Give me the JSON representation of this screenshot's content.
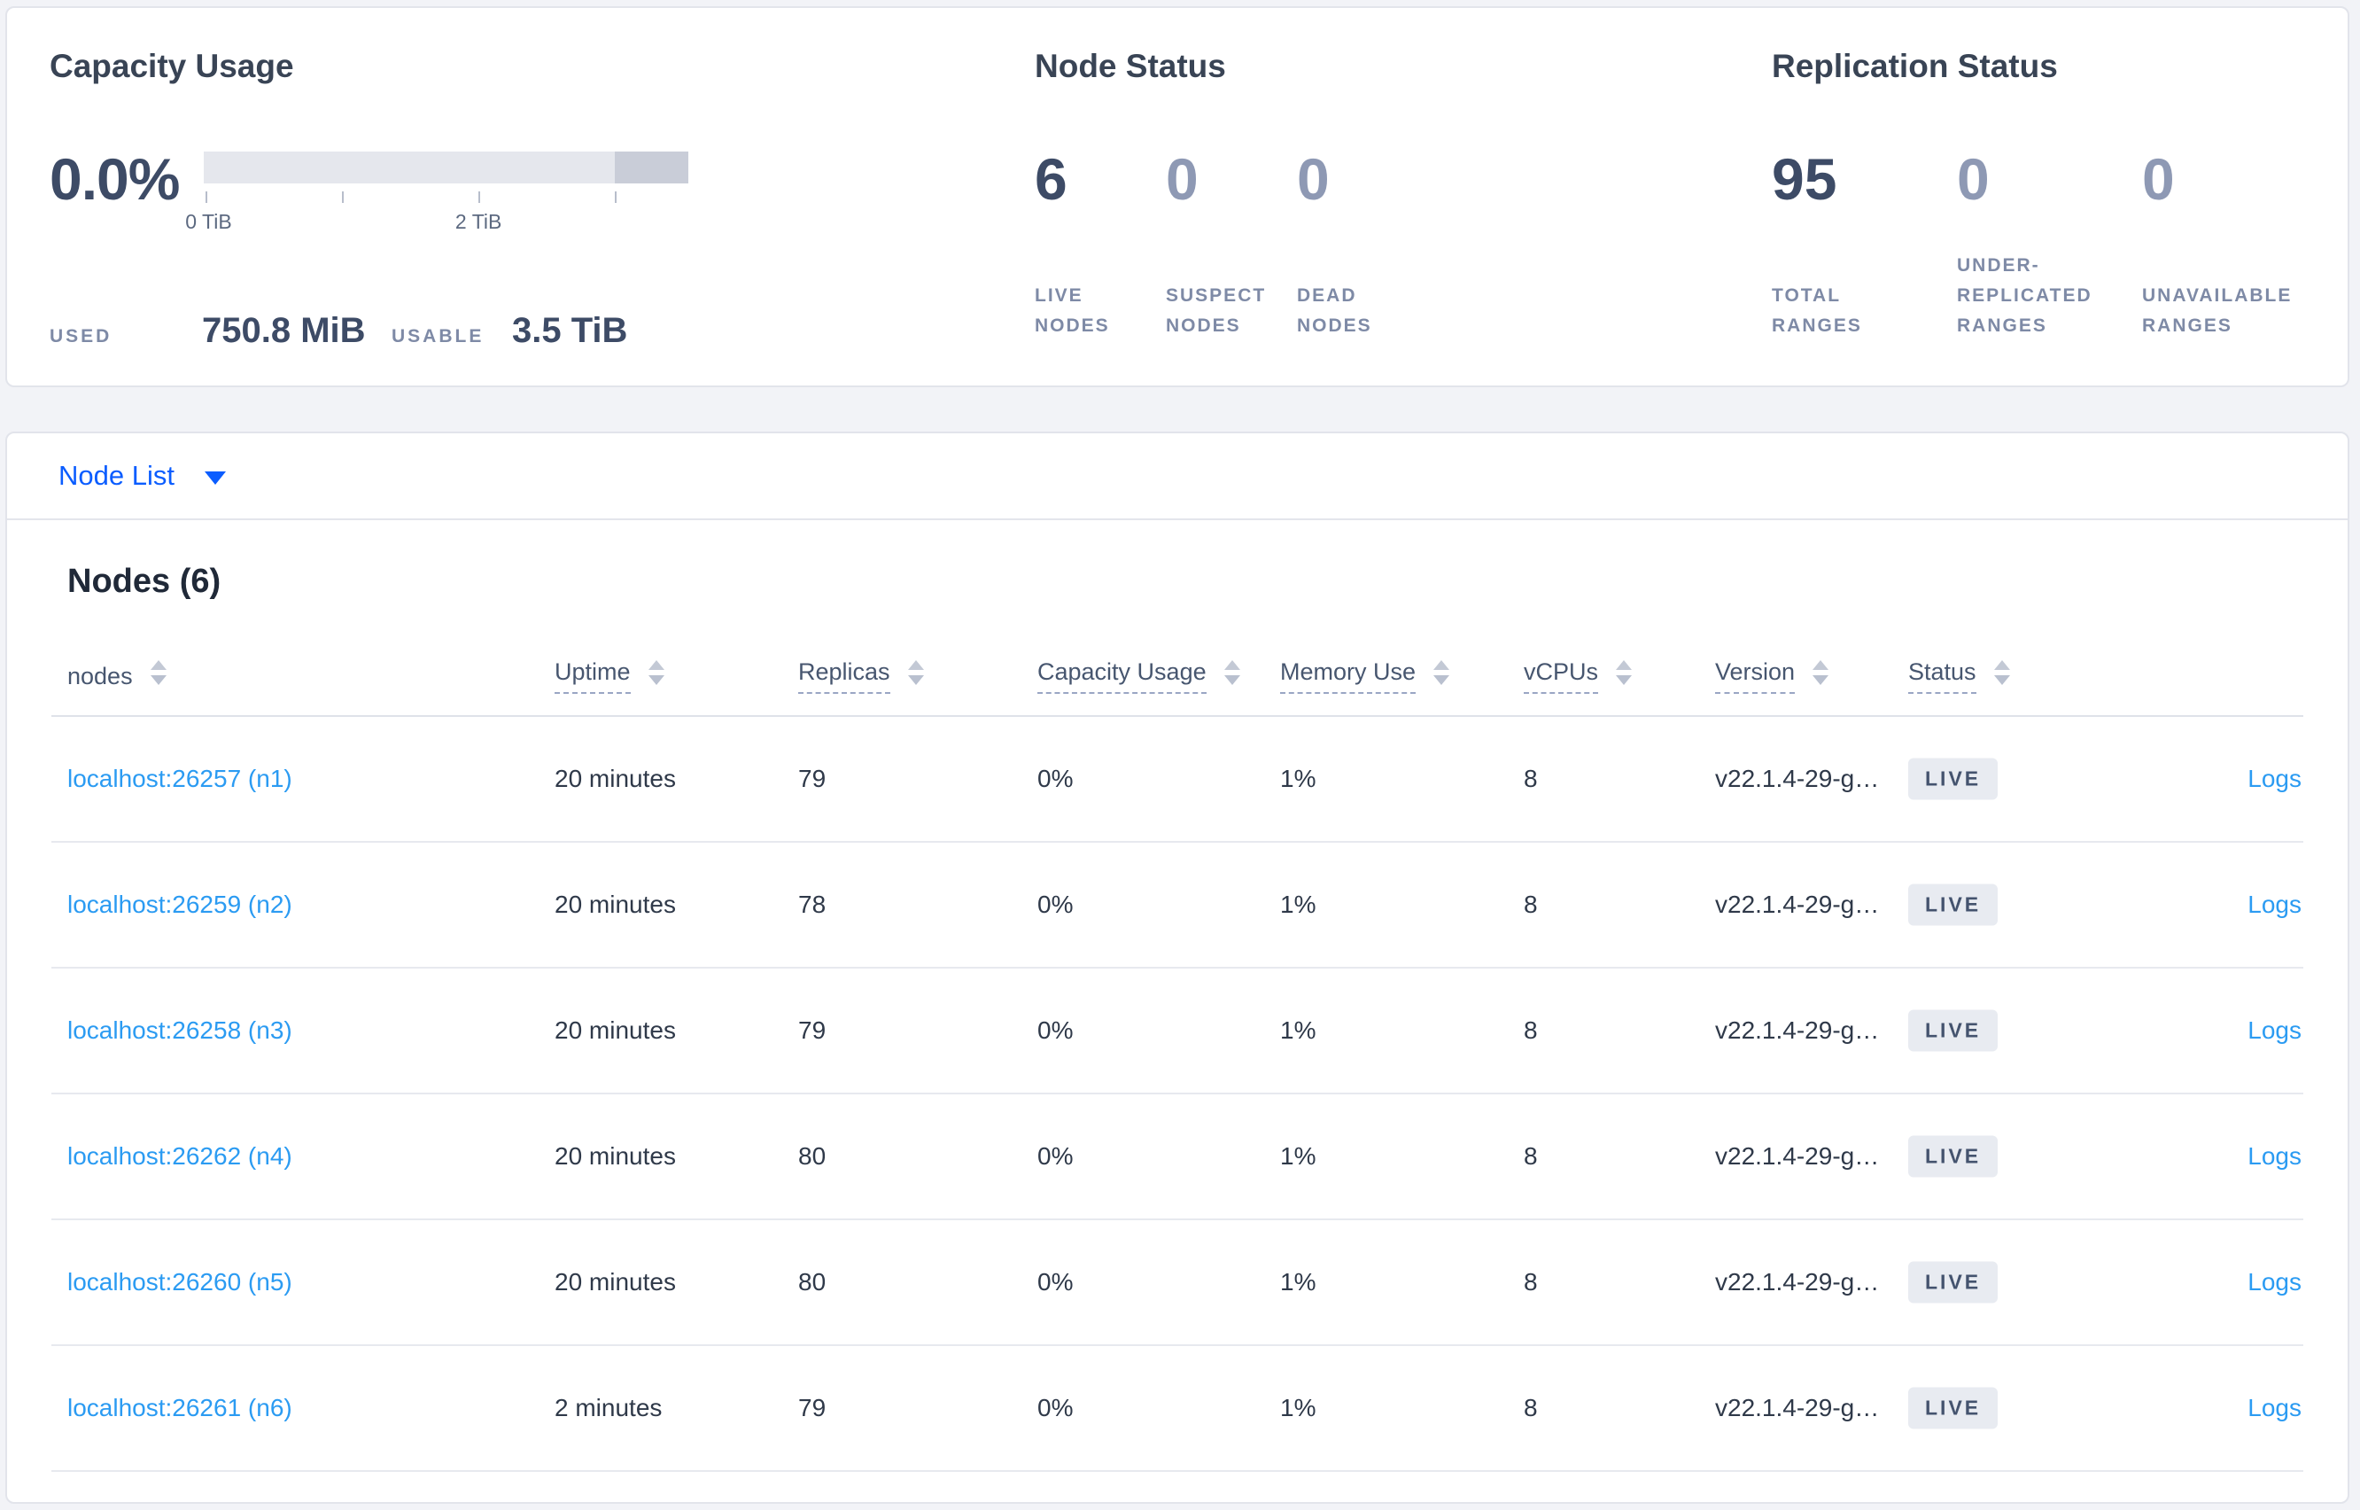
{
  "summary": {
    "capacity": {
      "title": "Capacity Usage",
      "percent": "0.0%",
      "tick_labels": [
        "0 TiB",
        "2 TiB"
      ],
      "used_label": "USED",
      "used_value": "750.8 MiB",
      "usable_label": "USABLE",
      "usable_value": "3.5 TiB"
    },
    "node_status": {
      "title": "Node Status",
      "stats": [
        {
          "value": "6",
          "label": "LIVE NODES"
        },
        {
          "value": "0",
          "label": "SUSPECT NODES"
        },
        {
          "value": "0",
          "label": "DEAD NODES"
        }
      ]
    },
    "replication": {
      "title": "Replication Status",
      "stats": [
        {
          "value": "95",
          "label": "TOTAL RANGES"
        },
        {
          "value": "0",
          "label": "UNDER-REPLICATED RANGES"
        },
        {
          "value": "0",
          "label": "UNAVAILABLE RANGES"
        }
      ]
    }
  },
  "node_list": {
    "dropdown_label": "Node List",
    "section_title": "Nodes (6)",
    "columns": [
      {
        "label": "nodes",
        "tooltip": false
      },
      {
        "label": "Uptime",
        "tooltip": true
      },
      {
        "label": "Replicas",
        "tooltip": true
      },
      {
        "label": "Capacity Usage",
        "tooltip": true
      },
      {
        "label": "Memory Use",
        "tooltip": true
      },
      {
        "label": "vCPUs",
        "tooltip": true
      },
      {
        "label": "Version",
        "tooltip": true
      },
      {
        "label": "Status",
        "tooltip": true
      }
    ],
    "rows": [
      {
        "node": "localhost:26257 (n1)",
        "uptime": "20 minutes",
        "replicas": "79",
        "capacity_usage": "0%",
        "memory_use": "1%",
        "vcpus": "8",
        "version": "v22.1.4-29-g…",
        "status": "LIVE",
        "logs": "Logs"
      },
      {
        "node": "localhost:26259 (n2)",
        "uptime": "20 minutes",
        "replicas": "78",
        "capacity_usage": "0%",
        "memory_use": "1%",
        "vcpus": "8",
        "version": "v22.1.4-29-g…",
        "status": "LIVE",
        "logs": "Logs"
      },
      {
        "node": "localhost:26258 (n3)",
        "uptime": "20 minutes",
        "replicas": "79",
        "capacity_usage": "0%",
        "memory_use": "1%",
        "vcpus": "8",
        "version": "v22.1.4-29-g…",
        "status": "LIVE",
        "logs": "Logs"
      },
      {
        "node": "localhost:26262 (n4)",
        "uptime": "20 minutes",
        "replicas": "80",
        "capacity_usage": "0%",
        "memory_use": "1%",
        "vcpus": "8",
        "version": "v22.1.4-29-g…",
        "status": "LIVE",
        "logs": "Logs"
      },
      {
        "node": "localhost:26260 (n5)",
        "uptime": "20 minutes",
        "replicas": "80",
        "capacity_usage": "0%",
        "memory_use": "1%",
        "vcpus": "8",
        "version": "v22.1.4-29-g…",
        "status": "LIVE",
        "logs": "Logs"
      },
      {
        "node": "localhost:26261 (n6)",
        "uptime": "2 minutes",
        "replicas": "79",
        "capacity_usage": "0%",
        "memory_use": "1%",
        "vcpus": "8",
        "version": "v22.1.4-29-g…",
        "status": "LIVE",
        "logs": "Logs"
      }
    ]
  },
  "colors": {
    "accent_blue": "#0b5dff",
    "link_blue": "#2b9bf2",
    "badge_bg": "#e8ebf1",
    "bar_light": "#e5e7ed",
    "bar_dark": "#c9cdd8"
  }
}
